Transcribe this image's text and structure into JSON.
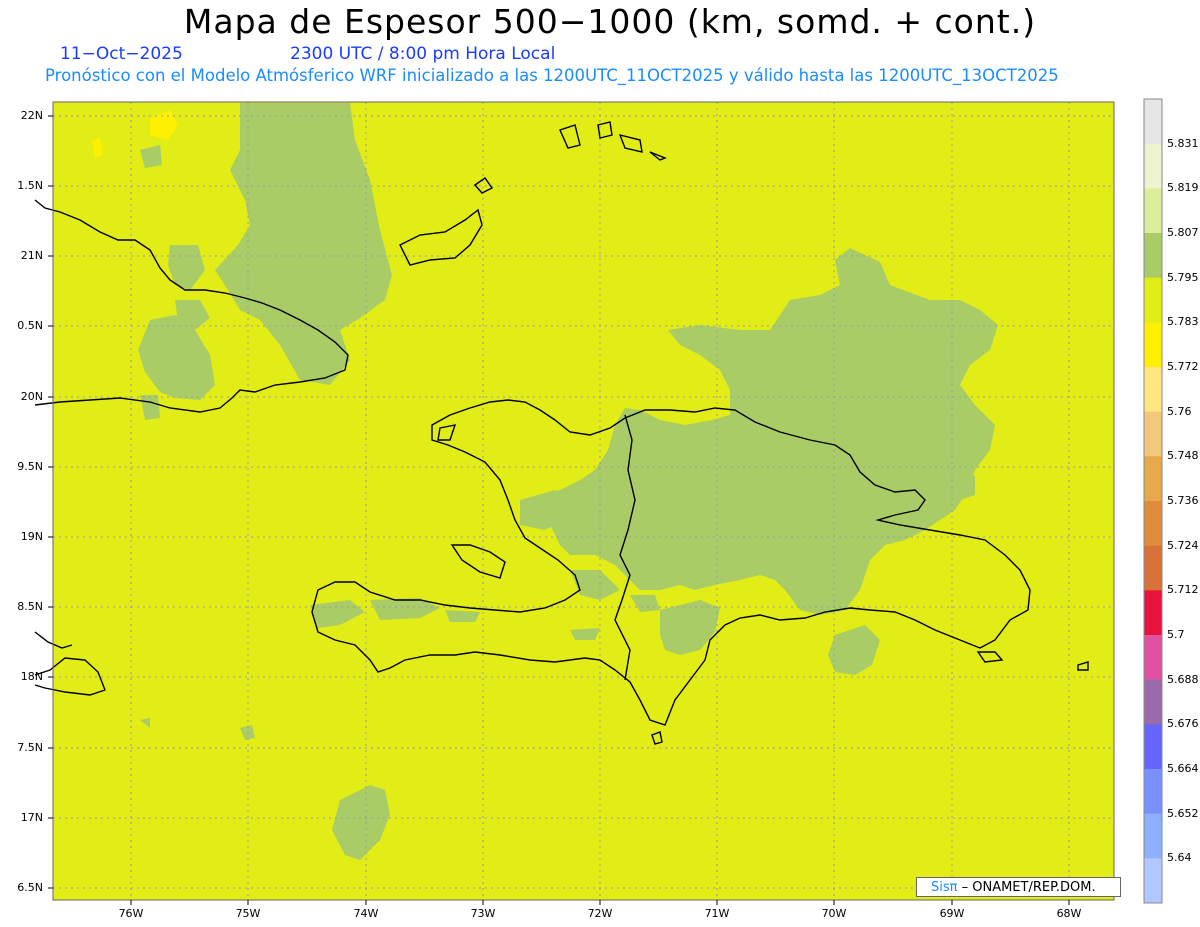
{
  "header": {
    "title": "Mapa de Espesor 500−1000 (km, somd. + cont.)",
    "date": "11−Oct−2025",
    "time": "2300 UTC / 8:00 pm Hora Local",
    "subtitle": "Pronóstico con el Modelo Atmósferico WRF inicializado a las 1200UTC_11OCT2025 y válido hasta las  1200UTC_13OCT2025"
  },
  "axes": {
    "y_labels": [
      "22N",
      "1.5N",
      "21N",
      "0.5N",
      "20N",
      "9.5N",
      "19N",
      "8.5N",
      "18N",
      "7.5N",
      "17N",
      "6.5N"
    ],
    "x_labels": [
      "76W",
      "75W",
      "74W",
      "73W",
      "72W",
      "71W",
      "70W",
      "69W",
      "68W"
    ]
  },
  "colorbar": {
    "labels": [
      "5.831",
      "5.819",
      "5.807",
      "5.795",
      "5.783",
      "5.772",
      "5.76",
      "5.748",
      "5.736",
      "5.724",
      "5.712",
      "5.7",
      "5.688",
      "5.676",
      "5.664",
      "5.652",
      "5.64"
    ],
    "colors": [
      "#e6e6e6",
      "#eef4d2",
      "#dcee9c",
      "#a9cc67",
      "#e2ec16",
      "#fff000",
      "#ffe680",
      "#f0c87a",
      "#e8a84c",
      "#e08c3c",
      "#d87238",
      "#e8123c",
      "#e050a0",
      "#9a6aaa",
      "#6666ff",
      "#7a90ff",
      "#8eb0ff",
      "#b0c8ff"
    ]
  },
  "map": {
    "background_color": "#e2ec16",
    "thicker_color": "#a9cc67",
    "thinner_color": "#fff000"
  },
  "credit": {
    "brand": "Sisπ",
    "org": " – ONAMET/REP.DOM."
  }
}
